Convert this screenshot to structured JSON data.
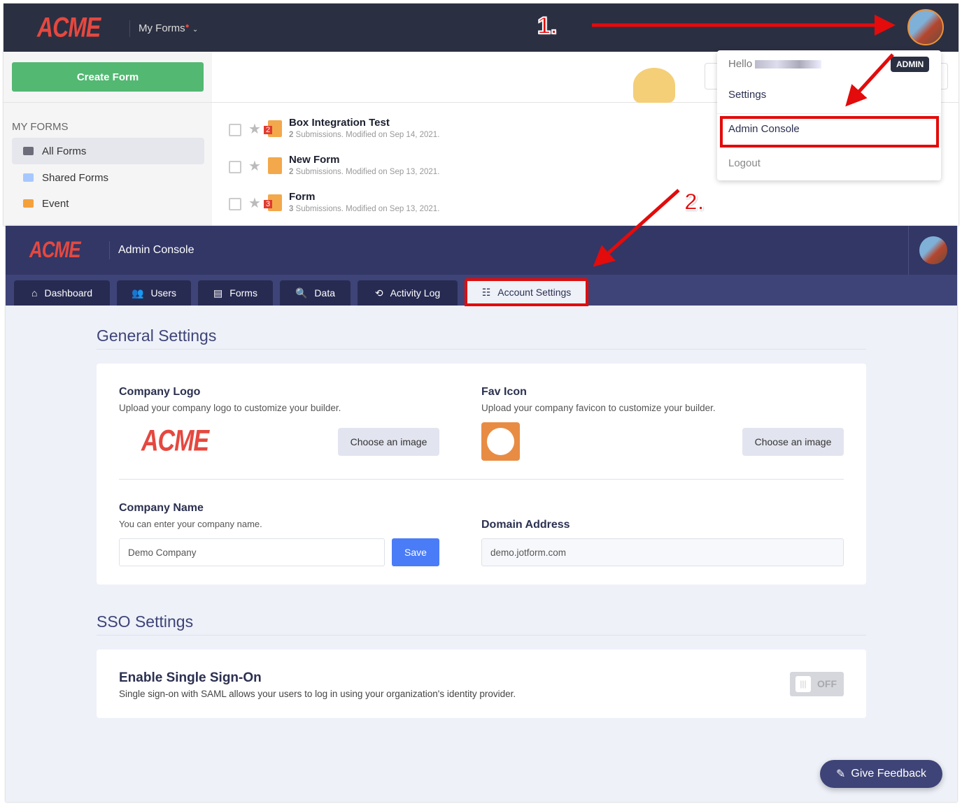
{
  "top": {
    "brand": "ACME",
    "nav_label": "My Forms",
    "create_button": "Create Form",
    "section_title": "MY FORMS",
    "folders": [
      {
        "label": "All Forms",
        "color": "#6c6c7a"
      },
      {
        "label": "Shared Forms",
        "color": "#a6c8ff"
      },
      {
        "label": "Event",
        "color": "#f4a13c"
      }
    ],
    "forms": [
      {
        "title": "Box Integration Test",
        "count": "2",
        "subtitle": "Submissions. Modified on Sep 14, 2021.",
        "badge": "2"
      },
      {
        "title": "New Form",
        "count": "2",
        "subtitle": "Submissions. Modified on Sep 13, 2021.",
        "badge": ""
      },
      {
        "title": "Form",
        "count": "3",
        "subtitle": "Submissions. Modified on Sep 13, 2021.",
        "badge": "3"
      }
    ],
    "menu": {
      "hello": "Hello",
      "badge": "ADMIN",
      "items": [
        "Settings",
        "Admin Console",
        "Logout"
      ]
    }
  },
  "annotations": {
    "step1": "1.",
    "step2": "2."
  },
  "admin": {
    "brand": "ACME",
    "title": "Admin Console",
    "tabs": [
      "Dashboard",
      "Users",
      "Forms",
      "Data",
      "Activity Log",
      "Account Settings"
    ],
    "general_title": "General Settings",
    "logo_label": "Company Logo",
    "logo_desc": "Upload your company logo to customize your builder.",
    "fav_label": "Fav Icon",
    "fav_desc": "Upload your company favicon to customize your builder.",
    "choose_image": "Choose an image",
    "name_label": "Company Name",
    "name_desc": "You can enter your company name.",
    "name_value": "Demo Company",
    "save": "Save",
    "domain_label": "Domain Address",
    "domain_value": "demo.jotform.com",
    "sso_title": "SSO Settings",
    "sso_label": "Enable Single Sign-On",
    "sso_desc": "Single sign-on with SAML allows your users to log in using your organization's identity provider.",
    "toggle": "OFF",
    "feedback": "Give Feedback"
  },
  "colors": {
    "accent": "#3e4477",
    "annotation": "#e30b0b",
    "green": "#53b872",
    "save": "#4a7cf7"
  }
}
